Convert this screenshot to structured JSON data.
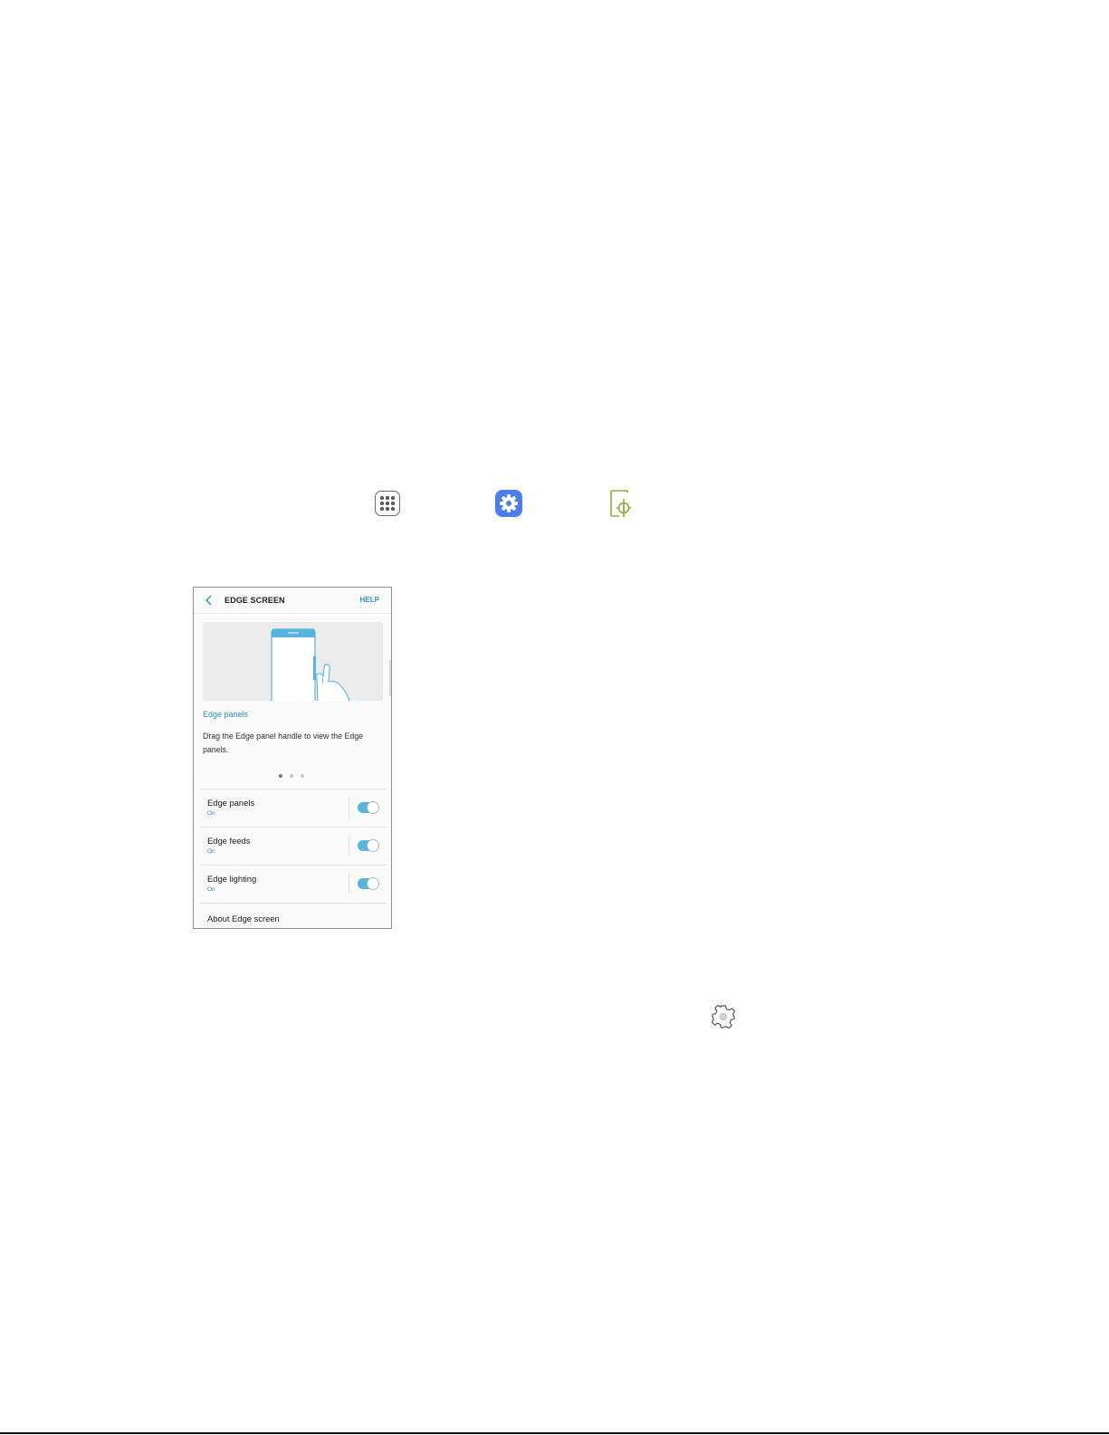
{
  "instruction_icons": {
    "apps": "apps-grid-icon",
    "settings": "settings-gear-icon",
    "edge_screen": "edge-screen-icon",
    "edge_settings": "gear-outline-icon"
  },
  "colors": {
    "accent": "#2f93c4",
    "toggle_on": "#55b5dc",
    "settings_icon": "#4c7df0",
    "edge_icon": "#8bb13c"
  },
  "edge_screen": {
    "title": "EDGE SCREEN",
    "help_label": "HELP",
    "feature": {
      "title": "Edge panels",
      "description": "Drag the Edge panel handle to view the Edge panels."
    },
    "pager": {
      "pages": 3,
      "active": 1
    },
    "settings": [
      {
        "label": "Edge panels",
        "status": "On",
        "enabled": true
      },
      {
        "label": "Edge feeds",
        "status": "On",
        "enabled": true
      },
      {
        "label": "Edge lighting",
        "status": "On",
        "enabled": true
      }
    ],
    "about_label": "About Edge screen"
  }
}
